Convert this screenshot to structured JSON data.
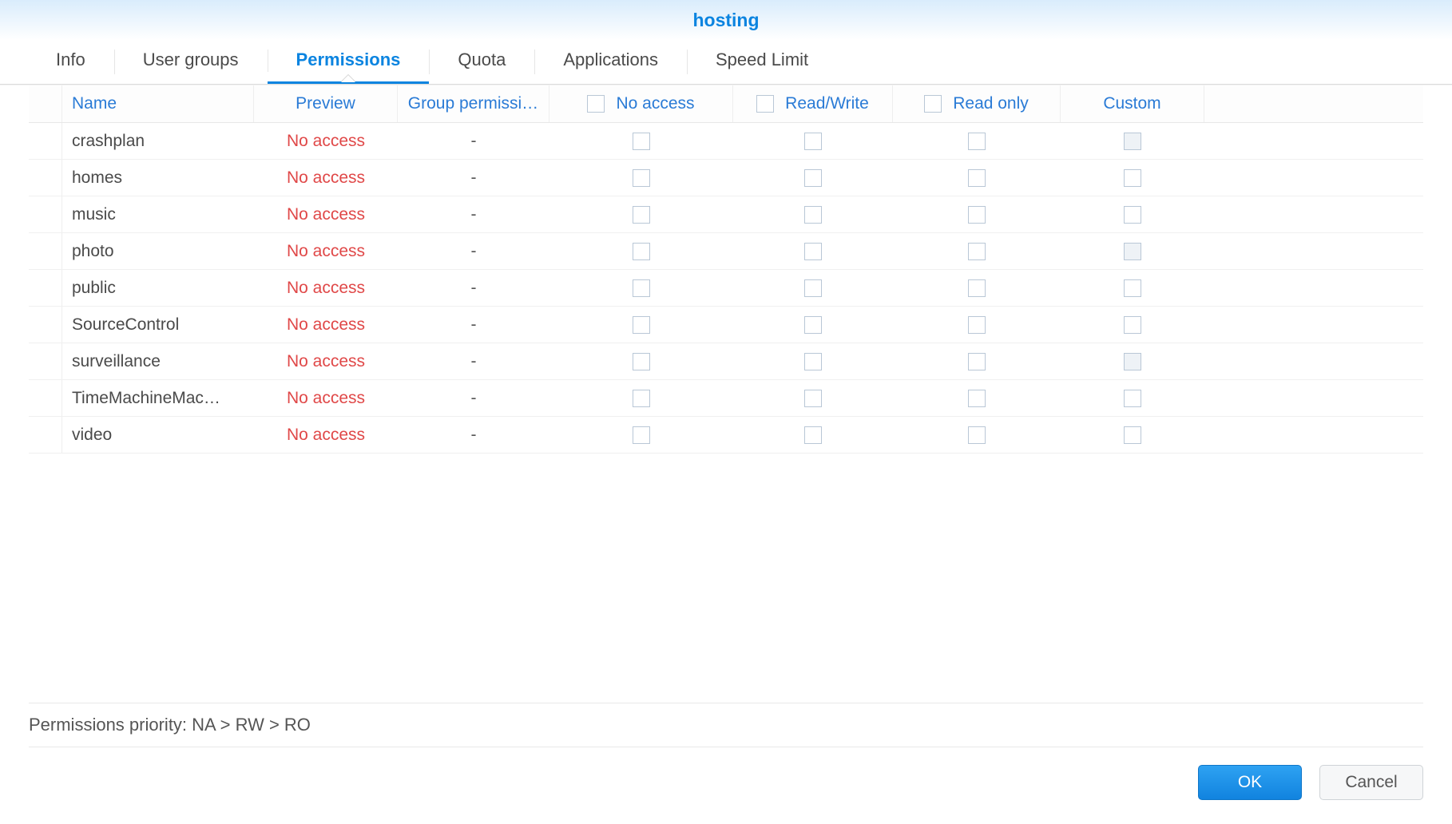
{
  "title": "hosting",
  "tabs": [
    {
      "label": "Info",
      "active": false
    },
    {
      "label": "User groups",
      "active": false
    },
    {
      "label": "Permissions",
      "active": true
    },
    {
      "label": "Quota",
      "active": false
    },
    {
      "label": "Applications",
      "active": false
    },
    {
      "label": "Speed Limit",
      "active": false
    }
  ],
  "columns": {
    "name": "Name",
    "preview": "Preview",
    "group": "Group permissi…",
    "no_access": "No access",
    "read_write": "Read/Write",
    "read_only": "Read only",
    "custom": "Custom"
  },
  "rows": [
    {
      "name": "crashplan",
      "preview": "No access",
      "group": "-",
      "no_access": false,
      "read_write": false,
      "read_only": false,
      "custom": false,
      "custom_shaded": true
    },
    {
      "name": "homes",
      "preview": "No access",
      "group": "-",
      "no_access": false,
      "read_write": false,
      "read_only": false,
      "custom": false,
      "custom_shaded": false
    },
    {
      "name": "music",
      "preview": "No access",
      "group": "-",
      "no_access": false,
      "read_write": false,
      "read_only": false,
      "custom": false,
      "custom_shaded": false
    },
    {
      "name": "photo",
      "preview": "No access",
      "group": "-",
      "no_access": false,
      "read_write": false,
      "read_only": false,
      "custom": false,
      "custom_shaded": true
    },
    {
      "name": "public",
      "preview": "No access",
      "group": "-",
      "no_access": false,
      "read_write": false,
      "read_only": false,
      "custom": false,
      "custom_shaded": false
    },
    {
      "name": "SourceControl",
      "preview": "No access",
      "group": "-",
      "no_access": false,
      "read_write": false,
      "read_only": false,
      "custom": false,
      "custom_shaded": false
    },
    {
      "name": "surveillance",
      "preview": "No access",
      "group": "-",
      "no_access": false,
      "read_write": false,
      "read_only": false,
      "custom": false,
      "custom_shaded": true
    },
    {
      "name": "TimeMachineMac…",
      "preview": "No access",
      "group": "-",
      "no_access": false,
      "read_write": false,
      "read_only": false,
      "custom": false,
      "custom_shaded": false
    },
    {
      "name": "video",
      "preview": "No access",
      "group": "-",
      "no_access": false,
      "read_write": false,
      "read_only": false,
      "custom": false,
      "custom_shaded": false
    }
  ],
  "priority_text": "Permissions priority: NA > RW > RO",
  "buttons": {
    "ok": "OK",
    "cancel": "Cancel"
  }
}
